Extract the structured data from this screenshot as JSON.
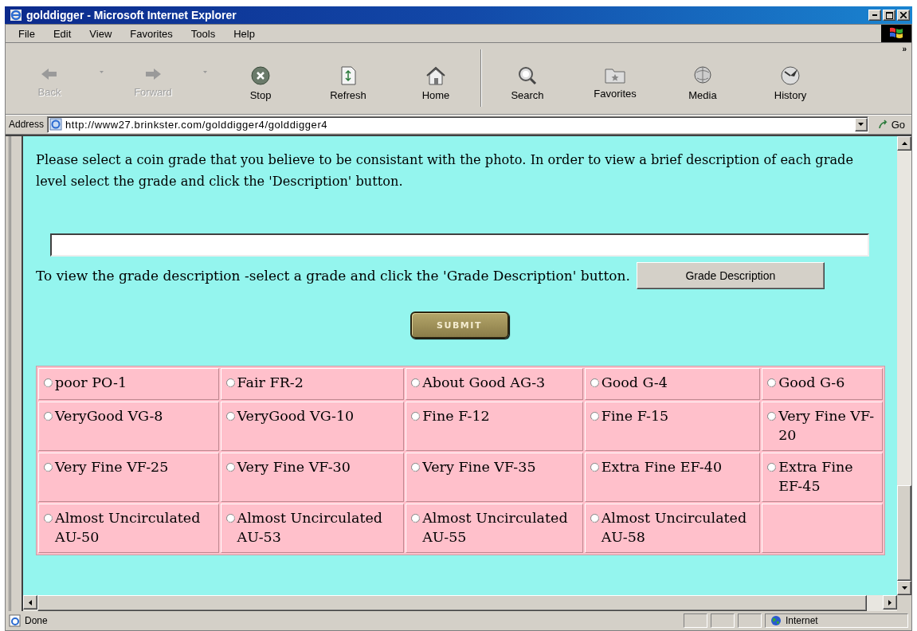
{
  "window": {
    "title": "golddigger - Microsoft Internet Explorer"
  },
  "menu": [
    "File",
    "Edit",
    "View",
    "Favorites",
    "Tools",
    "Help"
  ],
  "toolbar": [
    {
      "kind": "back",
      "label": "Back",
      "disabled": true,
      "dropdown": true
    },
    {
      "kind": "forward",
      "label": "Forward",
      "disabled": true,
      "dropdown": true
    },
    {
      "kind": "stop",
      "label": "Stop",
      "disabled": false,
      "dropdown": false
    },
    {
      "kind": "refresh",
      "label": "Refresh",
      "disabled": false,
      "dropdown": false
    },
    {
      "kind": "home",
      "label": "Home",
      "disabled": false,
      "dropdown": false
    },
    {
      "kind": "search",
      "label": "Search",
      "disabled": false,
      "dropdown": false
    },
    {
      "kind": "favorites",
      "label": "Favorites",
      "disabled": false,
      "dropdown": false
    },
    {
      "kind": "media",
      "label": "Media",
      "disabled": false,
      "dropdown": false
    },
    {
      "kind": "history",
      "label": "History",
      "disabled": false,
      "dropdown": false
    }
  ],
  "toolbar_more": "»",
  "address": {
    "label": "Address",
    "url": "http://www27.brinkster.com/golddigger4/golddigger4",
    "go": "Go"
  },
  "page": {
    "intro": "Please select a coin grade that you believe to be consistant with the photo. In order to view a brief description of each grade level select the grade and click the 'Description' button.",
    "hint": "To view the grade description -select a grade and click the 'Grade Description' button.",
    "grade_button": "Grade Description",
    "submit": "SUBMIT",
    "grades": [
      [
        {
          "label": "poor PO-1",
          "selected": false
        },
        {
          "label": "Fair FR-2",
          "selected": false
        },
        {
          "label": "About Good AG-3",
          "selected": false
        },
        {
          "label": "Good G-4",
          "selected": false
        },
        {
          "label": "Good G-6",
          "selected": false
        }
      ],
      [
        {
          "label": "VeryGood VG-8",
          "selected": false
        },
        {
          "label": "VeryGood VG-10",
          "selected": false
        },
        {
          "label": "Fine F-12",
          "selected": false
        },
        {
          "label": "Fine F-15",
          "selected": false
        },
        {
          "label": "Very Fine VF-20",
          "selected": false
        }
      ],
      [
        {
          "label": "Very Fine VF-25",
          "selected": false
        },
        {
          "label": "Very Fine VF-30",
          "selected": false
        },
        {
          "label": "Very Fine VF-35",
          "selected": false
        },
        {
          "label": "Extra Fine EF-40",
          "selected": false
        },
        {
          "label": "Extra Fine EF-45",
          "selected": false
        }
      ],
      [
        {
          "label": "Almost Uncirculated AU-50",
          "selected": false
        },
        {
          "label": "Almost Uncirculated AU-53",
          "selected": false
        },
        {
          "label": "Almost Uncirculated AU-55",
          "selected": false
        },
        {
          "label": "Almost Uncirculated AU-58",
          "selected": false
        }
      ]
    ]
  },
  "status": {
    "text": "Done",
    "zone": "Internet"
  }
}
